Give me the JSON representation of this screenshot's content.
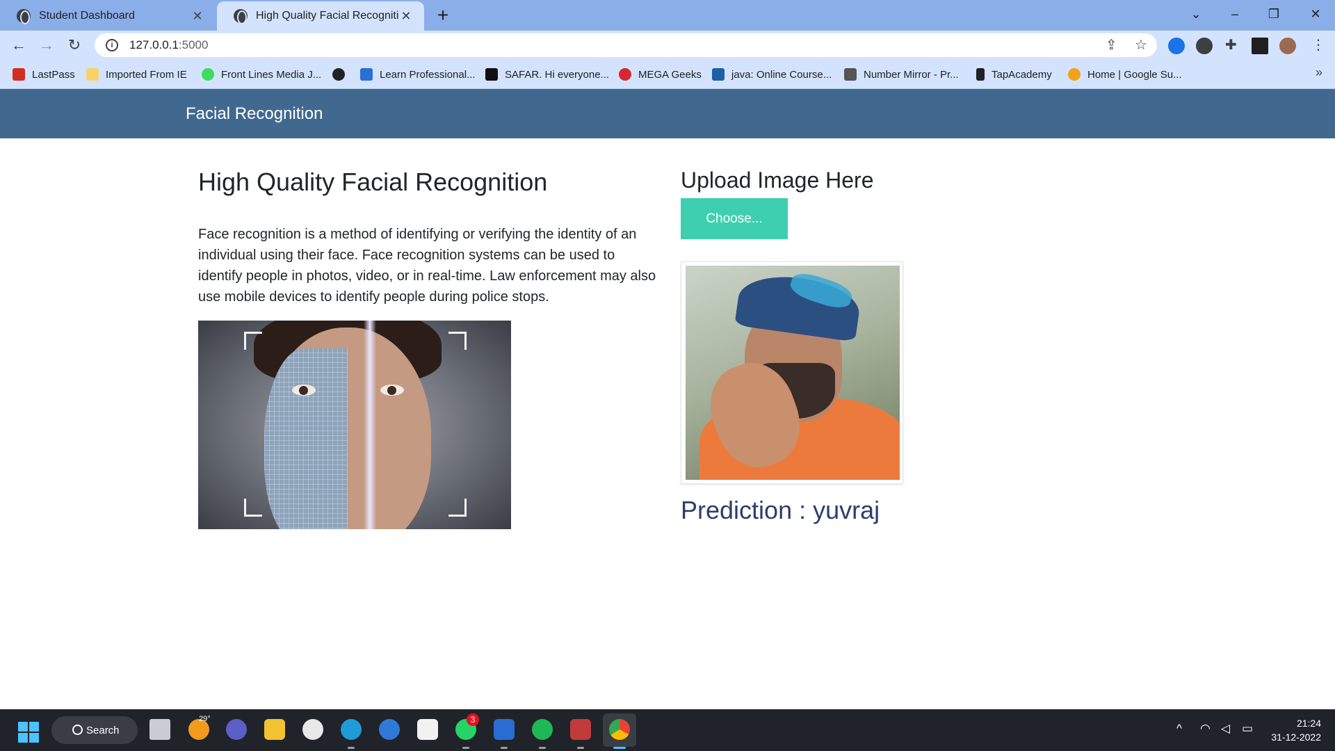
{
  "browser": {
    "tabs": [
      {
        "title": "Student Dashboard",
        "active": false
      },
      {
        "title": "High Quality Facial Recognition",
        "active": true
      }
    ],
    "url_host": "127.0.0.1",
    "url_port": ":5000",
    "bookmarks": [
      {
        "label": "LastPass",
        "color": "#d32d27"
      },
      {
        "label": "Imported From IE",
        "color": "#f6d26b"
      },
      {
        "label": "Front Lines Media J...",
        "color": "#3ddc5c"
      },
      {
        "label": "",
        "color": "#202124"
      },
      {
        "label": "Learn Professional...",
        "color": "#2a6fd6"
      },
      {
        "label": "SAFAR. Hi everyone...",
        "color": "#111111"
      },
      {
        "label": "MEGA Geeks",
        "color": "#d9272e"
      },
      {
        "label": "java: Online Course...",
        "color": "#1f5fa8"
      },
      {
        "label": "Number Mirror - Pr...",
        "color": "#555555"
      },
      {
        "label": "TapAcademy",
        "color": "#202124"
      },
      {
        "label": "Home | Google Su...",
        "color": "#f4a21b"
      }
    ]
  },
  "page": {
    "brand": "Facial Recognition",
    "hero_title": "High Quality Facial Recognition",
    "hero_text": "Face recognition is a method of identifying or verifying the identity of an individual using their face. Face recognition systems can be used to identify people in photos, video, or in real-time. Law enforcement may also use mobile devices to identify people during police stops.",
    "upload_title": "Upload Image Here",
    "choose_label": "Choose...",
    "prediction_label": "Prediction",
    "prediction_sep": " : ",
    "prediction_value": "yuvraj",
    "accent_color": "#3ecfb0",
    "nav_color": "#41698f"
  },
  "taskbar": {
    "search_label": "Search",
    "weather_temp": "29°",
    "whatsapp_badge": "3",
    "time": "21:24",
    "date": "31-12-2022"
  }
}
